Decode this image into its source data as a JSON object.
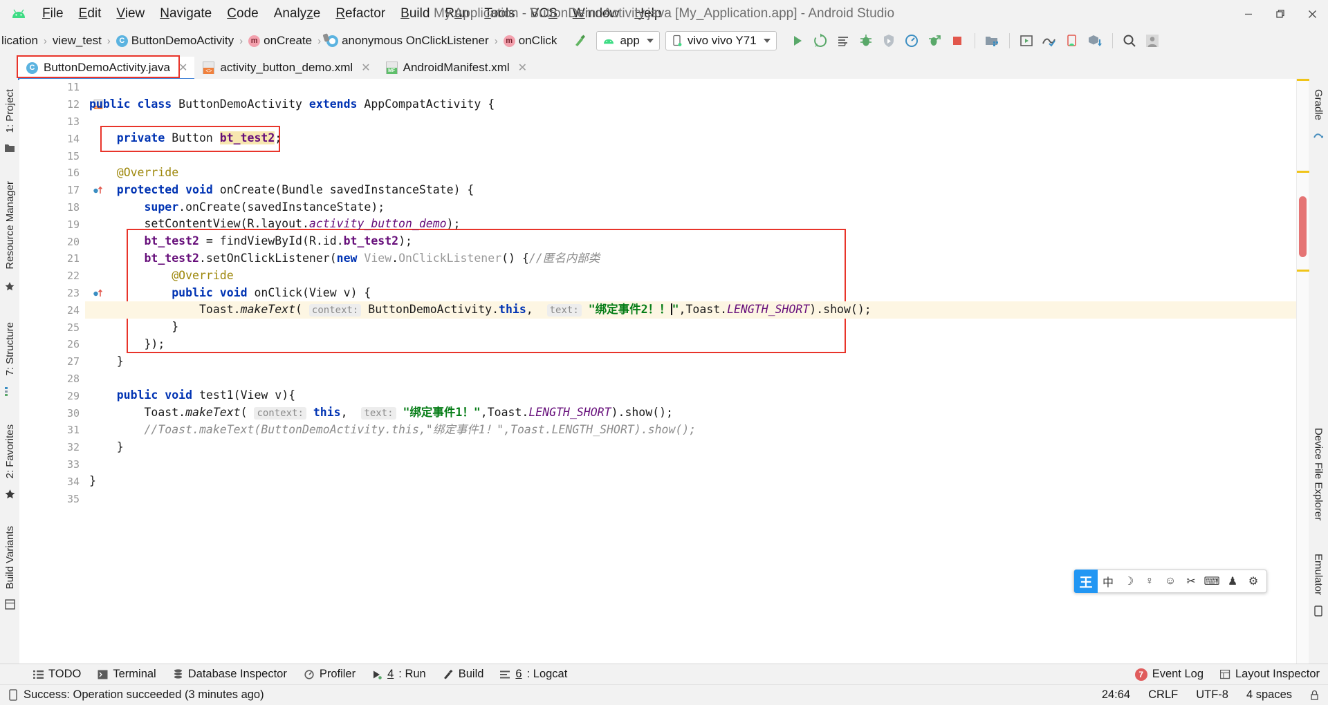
{
  "window": {
    "title": "My Application - ButtonDemoActivity.java [My_Application.app] - Android Studio",
    "minimize_label": "—",
    "maximize_label": "❐",
    "close_label": "✕"
  },
  "menu": [
    {
      "before": "",
      "mnemonic": "F",
      "after": "ile"
    },
    {
      "before": "",
      "mnemonic": "E",
      "after": "dit"
    },
    {
      "before": "",
      "mnemonic": "V",
      "after": "iew"
    },
    {
      "before": "",
      "mnemonic": "N",
      "after": "avigate"
    },
    {
      "before": "",
      "mnemonic": "C",
      "after": "ode"
    },
    {
      "before": "Analy",
      "mnemonic": "z",
      "after": "e"
    },
    {
      "before": "",
      "mnemonic": "R",
      "after": "efactor"
    },
    {
      "before": "",
      "mnemonic": "B",
      "after": "uild"
    },
    {
      "before": "R",
      "mnemonic": "u",
      "after": "n"
    },
    {
      "before": "",
      "mnemonic": "T",
      "after": "ools"
    },
    {
      "before": "VC",
      "mnemonic": "S",
      "after": ""
    },
    {
      "before": "",
      "mnemonic": "W",
      "after": "indow"
    },
    {
      "before": "",
      "mnemonic": "H",
      "after": "elp"
    }
  ],
  "breadcrumbs": [
    {
      "label": "lication",
      "icon": "none"
    },
    {
      "label": "view_test",
      "icon": "none"
    },
    {
      "label": "ButtonDemoActivity",
      "icon": "class-icon"
    },
    {
      "label": "onCreate",
      "icon": "method-icon"
    },
    {
      "label": "anonymous OnClickListener",
      "icon": "anonymous-class-icon"
    },
    {
      "label": "onClick",
      "icon": "method-icon"
    }
  ],
  "toolbar": {
    "module_combo": "app",
    "device_combo": "vivo vivo Y71",
    "icons": [
      "build-hammer-icon",
      "run-icon",
      "rerun-icon",
      "attach-icon",
      "debug-icon",
      "debug-attach-icon",
      "profiler-icon",
      "apply-changes-icon",
      "stop-icon",
      "sdk-manager-icon",
      "avd-manager-icon",
      "sync-gradle-icon",
      "device-manager-icon",
      "app-bundle-icon",
      "search-everywhere-icon",
      "account-icon"
    ]
  },
  "tabs": [
    {
      "label": "ButtonDemoActivity.java",
      "icon": "java-class-icon",
      "active": true,
      "close": "✕"
    },
    {
      "label": "activity_button_demo.xml",
      "icon": "xml-layout-icon",
      "active": false,
      "close": "✕"
    },
    {
      "label": "AndroidManifest.xml",
      "icon": "manifest-icon",
      "active": false,
      "close": "✕"
    }
  ],
  "left_rail": [
    "1: Project",
    "Resource Manager",
    "7: Structure",
    "2: Favorites",
    "Build Variants"
  ],
  "right_rail": [
    "Gradle",
    "Device File Explorer",
    "Emulator"
  ],
  "editor": {
    "first_line": 11,
    "lines": [
      {
        "n": 11,
        "text": ""
      },
      {
        "n": 12,
        "text": "public class ButtonDemoActivity extends AppCompatActivity {"
      },
      {
        "n": 13,
        "text": ""
      },
      {
        "n": 14,
        "text": "    private Button bt_test2;"
      },
      {
        "n": 15,
        "text": ""
      },
      {
        "n": 16,
        "text": "    @Override"
      },
      {
        "n": 17,
        "text": "    protected void onCreate(Bundle savedInstanceState) {"
      },
      {
        "n": 18,
        "text": "        super.onCreate(savedInstanceState);"
      },
      {
        "n": 19,
        "text": "        setContentView(R.layout.activity_button_demo);"
      },
      {
        "n": 20,
        "text": "        bt_test2 = findViewById(R.id.bt_test2);"
      },
      {
        "n": 21,
        "text": "        bt_test2.setOnClickListener(new View.OnClickListener() {//匿名内部类"
      },
      {
        "n": 22,
        "text": "            @Override"
      },
      {
        "n": 23,
        "text": "            public void onClick(View v) {"
      },
      {
        "n": 24,
        "text": "                Toast.makeText( context: ButtonDemoActivity.this,  text: \"绑定事件2！！\",Toast.LENGTH_SHORT).show();"
      },
      {
        "n": 25,
        "text": "            }"
      },
      {
        "n": 26,
        "text": "        });"
      },
      {
        "n": 27,
        "text": "    }"
      },
      {
        "n": 28,
        "text": ""
      },
      {
        "n": 29,
        "text": "    public void test1(View v){"
      },
      {
        "n": 30,
        "text": "        Toast.makeText( context: this,  text: \"绑定事件1！\",Toast.LENGTH_SHORT).show();"
      },
      {
        "n": 31,
        "text": "        //Toast.makeText(ButtonDemoActivity.this,\"绑定事件1！\",Toast.LENGTH_SHORT).show();"
      },
      {
        "n": 32,
        "text": "    }"
      },
      {
        "n": 33,
        "text": ""
      },
      {
        "n": 34,
        "text": "}"
      },
      {
        "n": 35,
        "text": ""
      }
    ],
    "param_hints": [
      "context:",
      "text:"
    ],
    "highlighted_identifier": "bt_test2",
    "current_line": 24,
    "annotation_boxes": [
      {
        "name": "tab-highlight-box"
      },
      {
        "name": "field-declaration-box"
      },
      {
        "name": "onclick-listener-box"
      }
    ]
  },
  "ime": {
    "logo": "王",
    "buttons": [
      "中",
      "☽",
      "♀",
      "☺",
      "✂",
      "⌨",
      "♟",
      "⚙"
    ]
  },
  "bottom_tools": [
    {
      "label": "TODO",
      "icon": "todo-icon",
      "mnemonic": ""
    },
    {
      "label": "Terminal",
      "icon": "terminal-icon",
      "mnemonic": ""
    },
    {
      "label": "Database Inspector",
      "icon": "database-icon",
      "mnemonic": ""
    },
    {
      "label": "Profiler",
      "icon": "profiler-icon",
      "mnemonic": ""
    },
    {
      "label": ": Run",
      "icon": "run-icon",
      "mnemonic": "4"
    },
    {
      "label": "Build",
      "icon": "build-icon",
      "mnemonic": ""
    },
    {
      "label": ": Logcat",
      "icon": "logcat-icon",
      "mnemonic": "6"
    }
  ],
  "bottom_right_tools": [
    {
      "label": "Event Log",
      "icon": "event-log-icon",
      "badge": "7"
    },
    {
      "label": "Layout Inspector",
      "icon": "layout-inspector-icon",
      "badge": ""
    }
  ],
  "status": {
    "message": "Success: Operation succeeded (3 minutes ago)",
    "caret": "24:64",
    "line_sep": "CRLF",
    "encoding": "UTF-8",
    "indent": "4 spaces"
  }
}
